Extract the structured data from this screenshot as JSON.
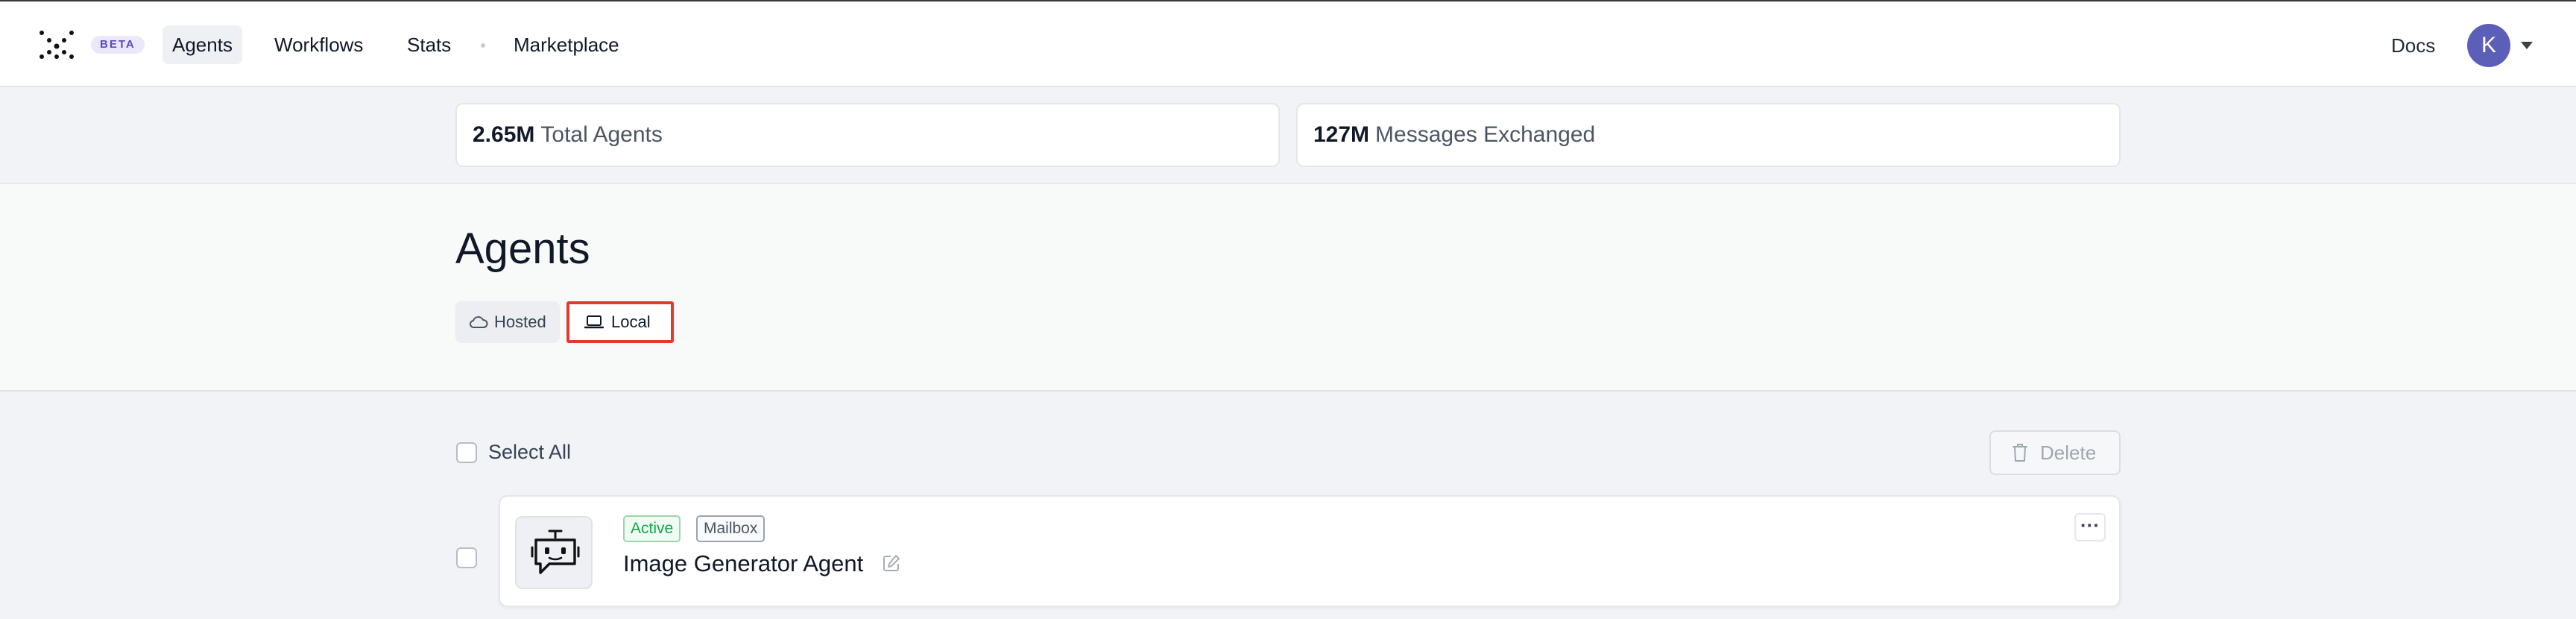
{
  "nav": {
    "beta_badge": "BETA",
    "items": [
      {
        "label": "Agents",
        "active": true
      },
      {
        "label": "Workflows",
        "active": false
      },
      {
        "label": "Stats",
        "active": false
      },
      {
        "label": "Marketplace",
        "active": false
      }
    ],
    "docs_label": "Docs",
    "avatar_initial": "K"
  },
  "stats": {
    "total_agents": {
      "value": "2.65M",
      "label": "Total Agents"
    },
    "messages": {
      "value": "127M",
      "label": "Messages Exchanged"
    }
  },
  "page": {
    "title": "Agents",
    "tabs": [
      {
        "label": "Hosted",
        "icon": "cloud-icon",
        "selected": false
      },
      {
        "label": "Local",
        "icon": "laptop-icon",
        "selected": true
      }
    ]
  },
  "list": {
    "select_all_label": "Select All",
    "delete_label": "Delete",
    "agents": [
      {
        "name": "Image Generator Agent",
        "tags": [
          "Active",
          "Mailbox"
        ],
        "icon": "robot-chat-icon",
        "more_label": "···"
      }
    ]
  },
  "colors": {
    "accent": "#5b5fb8",
    "highlight_border": "#e23b2d",
    "active_tag": "#16a34a"
  }
}
